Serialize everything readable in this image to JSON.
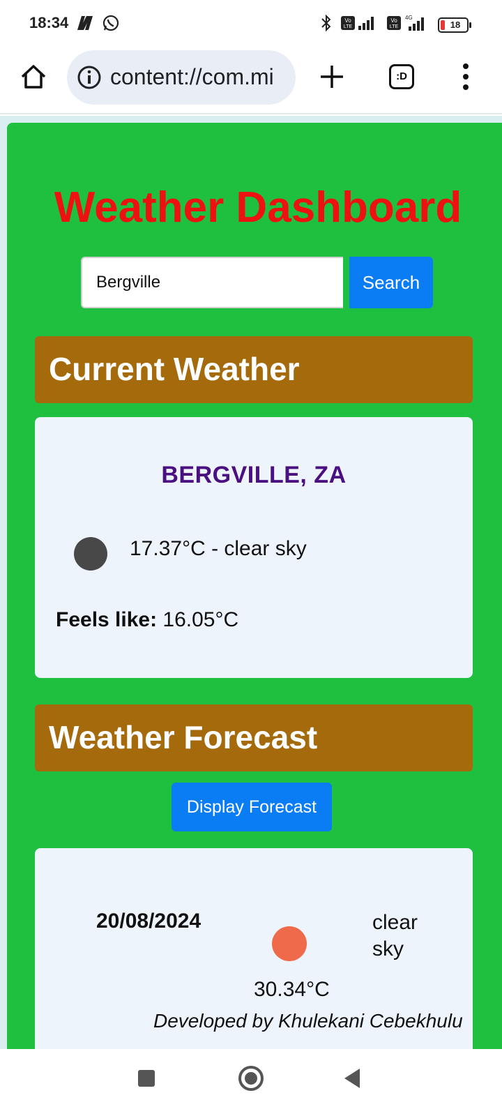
{
  "status_bar": {
    "time": "18:34",
    "battery": "18",
    "network_label": "4G"
  },
  "browser": {
    "url": "content://com.mi",
    "tabs_label": ":D"
  },
  "app": {
    "title": "Weather Dashboard",
    "search": {
      "value": "Bergville",
      "button_label": "Search"
    },
    "current": {
      "header": "Current Weather",
      "city": "BERGVILLE, ZA",
      "temp_desc": "17.37°C - clear sky",
      "feels_label": "Feels like:",
      "feels_value": "16.05°C"
    },
    "forecast": {
      "header": "Weather Forecast",
      "button_label": "Display Forecast",
      "items": [
        {
          "date": "20/08/2024",
          "desc_line1": "clear",
          "desc_line2": "sky",
          "temp": "30.34°C"
        }
      ]
    },
    "footer": "Developed by Khulekani Cebekhulu"
  },
  "colors": {
    "background": "#1fbf40",
    "title": "#ee1111",
    "section_header": "#a56a0c",
    "card": "#eef4fc",
    "button": "#0a7df5",
    "city": "#4a0f80"
  }
}
